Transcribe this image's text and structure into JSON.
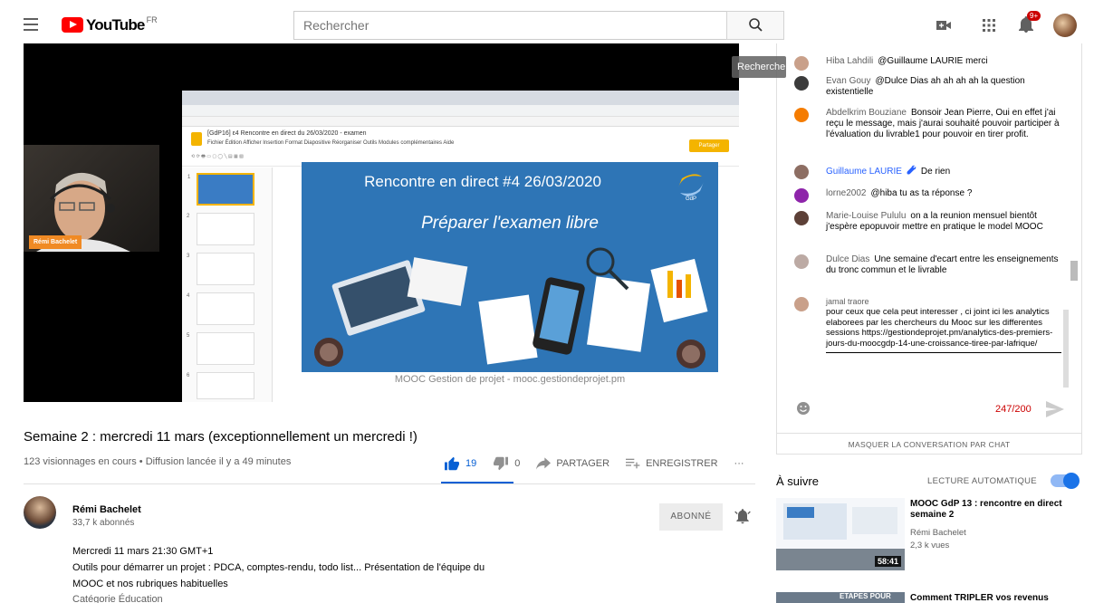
{
  "header": {
    "logo_text": "YouTube",
    "country": "FR",
    "search_placeholder": "Rechercher",
    "search_tooltip": "Rechercher",
    "notification_count": "9+"
  },
  "player": {
    "browser": {
      "doc_title": "[GdP16] ε4 Rencontre en direct du 26/03/2020 - examen",
      "doc_menu": "Fichier  Édition  Afficher  Insertion  Format  Diapositive  Réorganiser  Outils  Modules complémentaires  Aide",
      "share_label": "Partager"
    },
    "slide": {
      "title": "Rencontre en direct #4 26/03/2020",
      "subtitle": "Préparer l'examen libre",
      "footer": "MOOC Gestion de projet - mooc.gestiondeprojet.pm",
      "logo_text": "GdP"
    },
    "webcam_name": "Rémi Bachelet"
  },
  "video": {
    "title": "Semaine 2 : mercredi 11 mars (exceptionnellement un mercredi !)",
    "views": "123 visionnages en cours • Diffusion lancée il y a 49 minutes",
    "likes": "19",
    "dislikes": "0",
    "share": "PARTAGER",
    "save": "ENREGISTRER",
    "more": "···"
  },
  "channel": {
    "name": "Rémi Bachelet",
    "subscribers": "33,7 k abonnés",
    "subscribe_label": "ABONNÉ"
  },
  "description": {
    "line1": "Mercredi 11 mars 21:30 GMT+1",
    "line2": "Outils pour démarrer un projet : PDCA, comptes-rendu, todo list... Présentation de l'équipe du",
    "line3": "MOOC et nos rubriques habituelles",
    "line4": "Catégorie                Éducation"
  },
  "chat": {
    "messages": [
      {
        "author": "Hiba Lahdili",
        "text": "@Guillaume LAURIE merci",
        "color": "#c9a08a"
      },
      {
        "author": "Evan Gouy",
        "text": "@Dulce Dias ah ah ah ah la question existentielle",
        "color": "#3b3b3b"
      },
      {
        "author": "Abdelkrim Bouziane",
        "text": "Bonsoir Jean Pierre, Oui en effet j'ai reçu le message, mais j'aurai souhaité pouvoir participer à l'évaluation du livrable1 pour pouvoir en tirer profit.",
        "color": "#f57c00"
      },
      {
        "author": "Guillaume LAURIE",
        "text": "De rien",
        "color": "#8d6e63"
      },
      {
        "author": "lorne2002",
        "text": "@hiba tu as ta réponse ?",
        "color": "#8e24aa"
      },
      {
        "author": "Marie-Louise Pululu",
        "text": "on a la reunion mensuel bientôt j'espère epopuvoir mettre en pratique le model MOOC",
        "color": "#5d4037"
      },
      {
        "author": "Dulce Dias",
        "text": "Une semaine d'ecart entre les enseignements du tronc commun et le livrable",
        "color": "#bcaaa4"
      }
    ],
    "input_author": "jamal traore",
    "input_text": "pour ceux que cela peut interesser , ci joint ici les analytics elaborees par les chercheurs du Mooc sur les differentes sessions https://gestiondeprojet.pm/analytics-des-premiers-jours-du-moocgdp-14-une-croissance-tiree-par-lafrique/",
    "counter": "247/200",
    "hide_label": "MASQUER LA CONVERSATION PAR CHAT"
  },
  "upnext": {
    "label": "À suivre",
    "autoplay_label": "LECTURE AUTOMATIQUE",
    "videos": [
      {
        "title": "MOOC GdP 13 : rencontre en direct semaine 2",
        "channel": "Rémi Bachelet",
        "views": "2,3 k vues",
        "duration": "58:41"
      },
      {
        "title": "Comment TRIPLER vos revenus",
        "thumb_text": "ETAPES POUR"
      }
    ]
  },
  "colors": {
    "brand_red": "#ff0000",
    "link_blue": "#065fd4",
    "slide_blue": "#2e75b6",
    "counter_red": "#cc0000"
  }
}
